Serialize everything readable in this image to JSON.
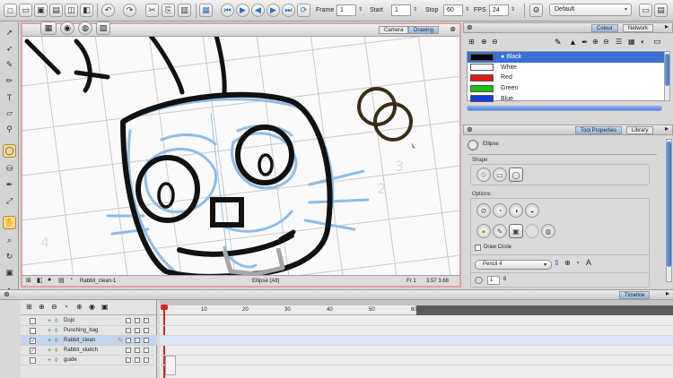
{
  "toolbar": {
    "frame_label": "Frame",
    "frame_value": "1",
    "start_label": "Start",
    "start_value": "1",
    "stop_label": "Stop",
    "stop_value": "60",
    "fps_label": "FPS",
    "fps_value": "24",
    "workspace": "Default"
  },
  "stage": {
    "tabs": [
      "Camera",
      "Drawing"
    ],
    "active_tab": "Drawing",
    "status_drawing": "Rabbit_clean-1",
    "status_tool": "Ellipse (Alt)",
    "status_frame": "Fr 1",
    "status_zoom": "3.57 3.68"
  },
  "colour_panel": {
    "tabs": [
      "Colour",
      "Network"
    ],
    "swatches": [
      {
        "name": "Black",
        "hex": "#000000",
        "selected": true
      },
      {
        "name": "White",
        "hex": "#ffffff",
        "selected": false
      },
      {
        "name": "Red",
        "hex": "#e01818",
        "selected": false
      },
      {
        "name": "Green",
        "hex": "#18c018",
        "selected": false
      },
      {
        "name": "Blue",
        "hex": "#1838d8",
        "selected": false
      }
    ]
  },
  "tool_properties": {
    "tabs": [
      "Tool Properties",
      "Library"
    ],
    "tool_name": "Ellipse",
    "shape_label": "Shape",
    "options_label": "Options",
    "draw_circle_label": "Draw Circle",
    "pencil_select": "Pencil 4",
    "size_value": "1",
    "size_extra": "6"
  },
  "timeline": {
    "tab": "Timeline",
    "ruler_ticks": [
      "10",
      "20",
      "30",
      "40",
      "50",
      "60"
    ],
    "layers": [
      {
        "name": "Dojo",
        "checked": false,
        "selected": false
      },
      {
        "name": "Punching_bag",
        "checked": false,
        "selected": false
      },
      {
        "name": "Rabbit_clean",
        "checked": true,
        "selected": true
      },
      {
        "name": "Rabbit_sketch",
        "checked": true,
        "selected": false
      },
      {
        "name": "guide",
        "checked": false,
        "selected": false
      }
    ]
  },
  "colors": {
    "accent": "#3b6fd1",
    "stage_border": "#e0a2a2",
    "playhead": "#e02020",
    "tool_active": "#f3d79a"
  }
}
